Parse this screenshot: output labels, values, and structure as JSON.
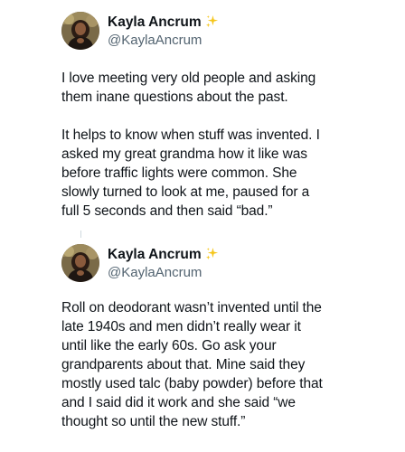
{
  "tweets": [
    {
      "author": {
        "display_name": "Kayla Ancrum",
        "handle": "@KaylaAncrum",
        "badge_icon": "sparkles-icon"
      },
      "paragraphs": [
        "I love meeting very old people and asking\nthem inane questions about the past.",
        "It helps to know when stuff was invented. I\nasked my great grandma how it like was\nbefore traffic lights were common. She\nslowly turned to look at me, paused for a\nfull 5 seconds and then said “bad.”"
      ]
    },
    {
      "author": {
        "display_name": "Kayla Ancrum",
        "handle": "@KaylaAncrum",
        "badge_icon": "sparkles-icon"
      },
      "paragraphs": [
        "Roll on deodorant wasn’t invented until the\nlate 1940s and men didn’t really wear it\nuntil like the early 60s. Go ask your\ngrandparents about that.  Mine said they\nmostly used talc (baby powder) before that\nand I said did it work and she said “we\nthought so until the new stuff.”"
      ]
    }
  ],
  "colors": {
    "text": "#0f1419",
    "secondary": "#536471",
    "sparkle": "#f5c518",
    "thread_line": "#cfd9de"
  }
}
